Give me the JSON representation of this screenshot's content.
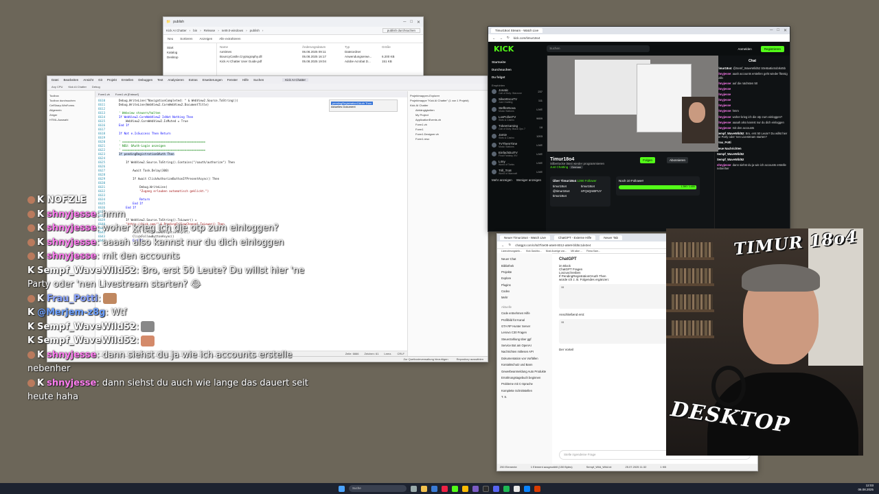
{
  "explorer": {
    "title": "publish",
    "path": [
      "Kick AI Chatter",
      "bin",
      "Release",
      "net9.0-windows",
      "publish"
    ],
    "search_placeholder": "publish durchsuchen",
    "toolbar": [
      "Neu",
      "Sortieren",
      "Anzeigen",
      "Alle extrahieren"
    ],
    "sidebar": [
      "Start",
      "Katalog",
      "Desktop"
    ],
    "columns": [
      "Name",
      "Änderungsdatum",
      "Typ",
      "Größe"
    ],
    "files": [
      [
        "runtimes",
        "06.08.2025 09:11",
        "Dateiordner",
        ""
      ],
      [
        "BouncyCastle.Cryptography.dll",
        "05.08.2025 16:17",
        "Anwendungserwe...",
        "6.200 KB"
      ],
      [
        "Kick AI Chatter User Guide.pdf",
        "05.08.2025 19:04",
        "Adobe Acrobat D...",
        "151 KB"
      ]
    ]
  },
  "vs": {
    "title": "Kick AI Chatter",
    "menu": [
      "Datei",
      "Bearbeiten",
      "Ansicht",
      "Git",
      "Projekt",
      "Erstellen",
      "Debuggen",
      "Test",
      "Analysieren",
      "Extras",
      "Erweiterungen",
      "Fenster",
      "Hilfe",
      "Suchen"
    ],
    "toolbar": [
      "Any CPU",
      "Kick AI Chatter",
      "Debug"
    ],
    "editor_tabs": [
      "Form1.vb",
      "Form1.vb [Entwurf]"
    ],
    "left_panel": [
      "Toolbox",
      "Toolbox durchsuchen",
      "CefSharp.WinForms",
      "Allgemein",
      "Zeiger",
      "HTML-Auswahl"
    ],
    "find_text": "pendingRegistrationOAuth Then",
    "find_label": "Aktuelles Dokument",
    "code": [
      {
        "n": "6610",
        "t": "Debug.WriteLine(\"NavigationCompleted: \" & WebView2.Source.ToString())",
        "c": ""
      },
      {
        "n": "6611",
        "t": "Debug.WriteLine(WebView2.CoreWebView2.DocumentTitle)",
        "c": ""
      },
      {
        "n": "6612",
        "t": "",
        "c": ""
      },
      {
        "n": "6613",
        "t": "' Webview steuern/halten",
        "c": "cm"
      },
      {
        "n": "6614",
        "t": "If WebView2.CoreWebView2 IsNot Nothing Then",
        "c": "kw"
      },
      {
        "n": "6615",
        "t": "    WebView2.CoreWebView2.IsMuted = True",
        "c": ""
      },
      {
        "n": "6616",
        "t": "End If",
        "c": "kw"
      },
      {
        "n": "6617",
        "t": "",
        "c": ""
      },
      {
        "n": "6618",
        "t": "If Not e.IsSuccess Then Return",
        "c": "kw"
      },
      {
        "n": "6619",
        "t": "",
        "c": ""
      },
      {
        "n": "6620",
        "t": "' ================================================",
        "c": "cm"
      },
      {
        "n": "6621",
        "t": "' NEU: OAuth-Login anzeigen",
        "c": "cm"
      },
      {
        "n": "6622",
        "t": "' ================================================",
        "c": "cm"
      },
      {
        "n": "6623",
        "t": "If pendingRegistrationOAuth Then",
        "c": "hl"
      },
      {
        "n": "6624",
        "t": "",
        "c": ""
      },
      {
        "n": "6625",
        "t": "    If WebView2.Source.ToString().Contains(\"/oauth/authorize\") Then",
        "c": ""
      },
      {
        "n": "6626",
        "t": "",
        "c": ""
      },
      {
        "n": "6627",
        "t": "        Await Task.Delay(300)",
        "c": ""
      },
      {
        "n": "6628",
        "t": "",
        "c": ""
      },
      {
        "n": "6629",
        "t": "        If Await ClickAuthorizeButtonIfPresentAsync() Then",
        "c": ""
      },
      {
        "n": "6630",
        "t": "",
        "c": ""
      },
      {
        "n": "6631",
        "t": "            Debug.WriteLine(",
        "c": ""
      },
      {
        "n": "6632",
        "t": "            \"Zugang erlauben automatisch geklickt.\")",
        "c": "st"
      },
      {
        "n": "6633",
        "t": "",
        "c": ""
      },
      {
        "n": "6634",
        "t": "            Return",
        "c": "kw"
      },
      {
        "n": "6635",
        "t": "        End If",
        "c": "kw"
      },
      {
        "n": "6636",
        "t": "    End If",
        "c": "kw"
      },
      {
        "n": "6637",
        "t": "",
        "c": ""
      },
      {
        "n": "6638",
        "t": "",
        "c": ""
      },
      {
        "n": "6639",
        "t": "    If WebView2.Source.ToString().ToLower() =",
        "c": ""
      },
      {
        "n": "6640",
        "t": "    \"https://kick.com/\" & PendingFollowChannel.ToLower() Then",
        "c": "st"
      },
      {
        "n": "6641",
        "t": "",
        "c": ""
      },
      {
        "n": "6642",
        "t": "        Await AutoFollowNavigationAsync()",
        "c": ""
      },
      {
        "n": "6643",
        "t": "        ClickFollowButtonAsync()",
        "c": ""
      },
      {
        "n": "6644",
        "t": "        End If",
        "c": "kw"
      }
    ],
    "editor_status": [
      "Zeile: 6666",
      "Zeichen: 61",
      "Leerz.",
      "CRLF"
    ],
    "right_panel": [
      "Projektmappen-Explorer",
      "Projektmappe \"Kick AI Chatter\" (1 von 1 Projekt)",
      "Kick AI Chatter",
      "Abhängigkeiten",
      "My Project",
      "ApplicationEvents.vb",
      "Form1.vb",
      "Form1",
      "Form1.Designer.vb",
      "Form1.resx"
    ],
    "status": [
      "Zur Quellcodeverwaltung hinzufügen",
      "Repository auswählen"
    ]
  },
  "kick": {
    "tab": "Timur18o4 Stream - Watch Live",
    "url": "kick.com/timur18o4",
    "search_placeholder": "Suchen",
    "login": "Anmelden",
    "register": "Registrieren",
    "nav": [
      "Startseite",
      "Durchsuchen",
      "Du folgst"
    ],
    "recommended_label": "Empfohlen",
    "channels": [
      {
        "name": "Jonatic",
        "cat": "Call of Duty: Warzone",
        "viewers": "237"
      },
      {
        "name": "SilverEscoTV",
        "cat": "Just Chatting",
        "viewers": "111"
      },
      {
        "name": "SteffenNova",
        "cat": "Music Stations",
        "viewers": "LIVE"
      },
      {
        "name": "LosPollosTV",
        "cat": "Slots & Casino",
        "viewers": "9659"
      },
      {
        "name": "TxkeeGaming",
        "cat": "Call of Duty: Black Ops 7",
        "viewers": "18"
      },
      {
        "name": "Jamie",
        "cat": "Slots & Casino",
        "viewers": "1203"
      },
      {
        "name": "TVThemTime",
        "cat": "Music Stations",
        "viewers": "LIVE"
      },
      {
        "name": "EinfachDutTV",
        "cat": "Final Fantasy XIV",
        "viewers": "LIVE"
      },
      {
        "name": "L4ny",
        "cat": "World of Tanks",
        "viewers": "LIVE"
      },
      {
        "name": "Trill_Tro8",
        "cat": "World of Warcraft",
        "viewers": "LIVE"
      }
    ],
    "more": [
      "Mehr anzeigen",
      "Weniger anzeigen"
    ],
    "streamer": "Timur18o4",
    "stream_title": "Silbertocke lässt wieder programmieren",
    "category": "Just Chatting",
    "lang": "German",
    "follow": "Folgen",
    "subscribe": "Abonnieren",
    "about_title": "Über Timur18o4",
    "followers": "1390 Follower",
    "socials": [
      "timur18o4",
      "timur18o4",
      "@timur18o4",
      "nFQsQmBFUY",
      "timur18o4"
    ],
    "goal_title": "Noch 10 Follower!",
    "goal_text": "1.390 / 1.400",
    "goal_fraction": 0.993,
    "chat_title": "Chat",
    "chat_msgs": [
      {
        "u": "Timur18o4",
        "t": "@Semf_WaveWild52 S0eBa8ixSobIk45b"
      },
      {
        "u": "shnyjesse",
        "t": "aaah accounts erstellen geht wieder flüssig gallo"
      },
      {
        "u": "shnyjesse",
        "t": "auf die nächsten 50"
      },
      {
        "u": "shnyjesse",
        "t": ""
      },
      {
        "u": "shnyjesse",
        "t": ""
      },
      {
        "u": "shnyjesse",
        "t": ""
      },
      {
        "u": "shnyjesse",
        "t": ""
      },
      {
        "u": "shnyjesse",
        "t": "hmm"
      },
      {
        "u": "shnyjesse",
        "t": "woher krieg ich die otp zum einloggen?"
      },
      {
        "u": "shnyjesse",
        "t": "aaaah also kannst nur du dich einloggen"
      },
      {
        "u": "shnyjesse",
        "t": "mit den accounts"
      },
      {
        "u": "Sempf_WaveWild52",
        "t": "Bro, erst 50 Leute? Du willst hier 'ne Party oder 'nen Livestream starten?"
      },
      {
        "u": "Frau_Potti",
        "t": ""
      },
      {
        "u": "Neue Nachrichten",
        "t": ""
      },
      {
        "u": "Sempf_WaveWild52",
        "t": ""
      },
      {
        "u": "Sempf_WaveWild52",
        "t": ""
      },
      {
        "u": "shnyjesse",
        "t": "dann siehst du ja wie ich accounts erstelle nebenher"
      }
    ]
  },
  "gpt": {
    "tabs": [
      "Neuer Timur18o4 - Watch Live",
      "ChatGPT - Externe Hilfe",
      "Neuer Tab"
    ],
    "url": "chatgpt.com/c/6d7f4e08-a6e8-8012-a8e9-bfd5c1de3e4",
    "bookmarks": [
      "Lizenzierungsinfo...",
      "Kick Dashbo...",
      "Most Anzeige von...",
      "Mit alice ...",
      "Firma Kam..."
    ],
    "model": "ChatGPT",
    "sidebar": [
      "Neuer Chat",
      "Bibliothek",
      "Projekte",
      "Explore",
      "Plugins",
      "Codex",
      "Mehr"
    ],
    "recent_label": "Aktuelle",
    "recent": [
      "Code entnehmen Hilfe",
      "Profilbild für Kanal",
      "GTA RP Hunter Server",
      "Lenovo C30 Fragen",
      "Steuerzahlung über ggf",
      "Service Bot am OpenAI",
      "Nachrichten mitlesen API",
      "Dokumentation von Vorfällen",
      "Kontaktschutz und Bann",
      "Gewerbeanmeldung Auto Produkte",
      "Ernährungstagebuch beginnen",
      "Probleme mit C-Sprache",
      "Komplette Schnittstellen"
    ],
    "content": [
      "im Block",
      "ChatGPT Fragen",
      "Loszuschreiben",
      "If PendingRegistrationOAuth Then",
      "würde ich z. B. Folgendes ergänzen:",
      "VB",
      "Anschließend erst:",
      "VB",
      "Der Vorteil"
    ],
    "input_placeholder": "Stelle irgendeine Frage",
    "user_initial": "T. S.",
    "status": [
      "250 Elemente",
      "1 Element ausgewählt (150 Bytes)",
      "Sempf_Wild_Wild.txt",
      "25.07.2025 11:32",
      "1 KB"
    ]
  },
  "webcam": {
    "logo_top": "TIMUR 18o4",
    "logo_bottom": "DESKTOP"
  },
  "chat_overlay": [
    {
      "user": "NOFZLE",
      "text": "",
      "style": "w",
      "badge": true
    },
    {
      "user": "shnyjesse",
      "text": ": hmm",
      "style": "",
      "badge": true
    },
    {
      "user": "shnyjesse",
      "text": ": woher krieg ich die otp zum einloggen?",
      "style": "",
      "badge": true
    },
    {
      "user": "shnyjesse",
      "text": ": aaaah also kannst nur du dich einloggen",
      "style": "",
      "badge": true
    },
    {
      "user": "shnyjesse",
      "text": ": mit den accounts",
      "style": "",
      "badge": true
    },
    {
      "user": "Sempf_WaveWild52",
      "text": ": Bro, erst 50 Leute? Du willst hier 'ne Party oder 'nen Livestream starten? 😂",
      "style": "w",
      "badge": false
    },
    {
      "user": "Frau_Potti",
      "text": ":",
      "style": "potti",
      "badge": true
    },
    {
      "user": "@Merjem-z8g",
      "text": ": Wtf",
      "style": "merjem",
      "badge": false
    },
    {
      "user": "Sempf_WaveWild52",
      "text": ":",
      "style": "w",
      "badge": false
    },
    {
      "user": "Sempf_WaveWild52",
      "text": ":",
      "style": "w",
      "badge": false
    },
    {
      "user": "shnyjesse",
      "text": ": dann siehst du ja wie ich accounts erstelle nebenher",
      "style": "",
      "badge": true
    },
    {
      "user": "shnyjesse",
      "text": ": dann siehst du auch wie lange das dauert seit heute haha",
      "style": "",
      "badge": true
    }
  ],
  "taskbar": {
    "search_placeholder": "Suche",
    "time": "12:03",
    "date": "06.08.2025"
  }
}
